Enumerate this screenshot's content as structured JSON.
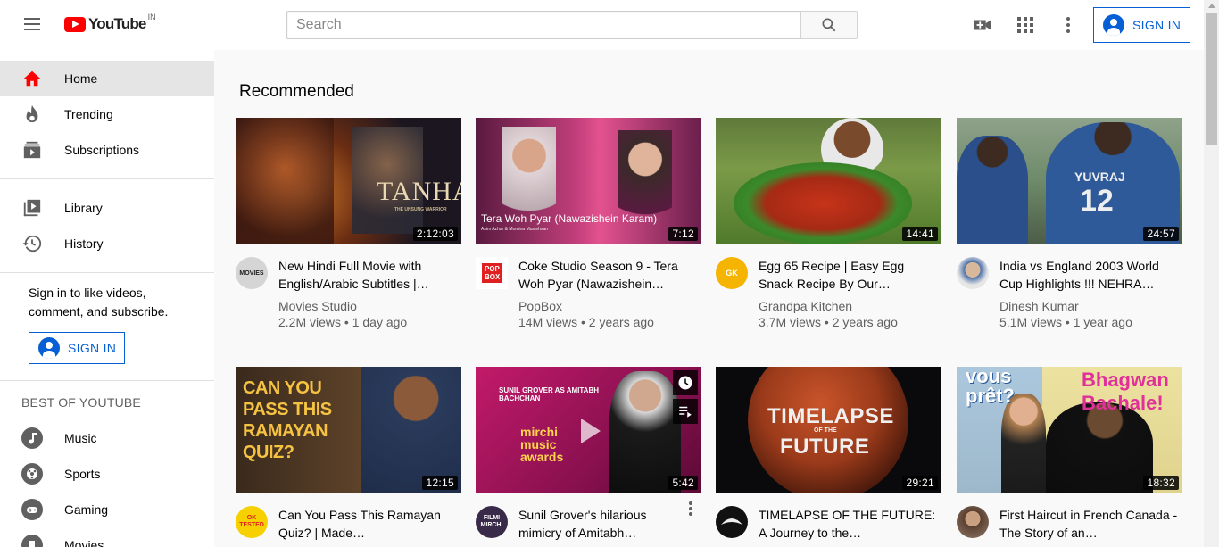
{
  "header": {
    "logo_text": "YouTube",
    "logo_country": "IN",
    "search_placeholder": "Search",
    "signin_label": "SIGN IN"
  },
  "sidebar": {
    "main_items": [
      {
        "label": "Home",
        "icon": "home-icon"
      },
      {
        "label": "Trending",
        "icon": "flame-icon"
      },
      {
        "label": "Subscriptions",
        "icon": "subscriptions-icon"
      }
    ],
    "library_items": [
      {
        "label": "Library",
        "icon": "library-icon"
      },
      {
        "label": "History",
        "icon": "history-icon"
      }
    ],
    "signin_message": "Sign in to like videos, comment, and subscribe.",
    "signin_label": "SIGN IN",
    "best_heading": "BEST OF YOUTUBE",
    "best_items": [
      {
        "label": "Music",
        "icon": "music-icon"
      },
      {
        "label": "Sports",
        "icon": "sports-icon"
      },
      {
        "label": "Gaming",
        "icon": "gaming-icon"
      },
      {
        "label": "Movies",
        "icon": "movies-icon"
      }
    ]
  },
  "main": {
    "section_title": "Recommended",
    "videos": [
      {
        "title": "New Hindi Full Movie with English/Arabic Subtitles |…",
        "channel": "Movies Studio",
        "stats": "2.2M views • 1 day ago",
        "duration": "2:12:03",
        "thumb_text": "TANHAJI",
        "thumb_subtext": "THE UNSUNG WARRIOR",
        "avatar_text": "MOVIES"
      },
      {
        "title": "Coke Studio Season 9 - Tera Woh Pyar (Nawazishein…",
        "channel": "PopBox",
        "stats": "14M views • 2 years ago",
        "duration": "7:12",
        "thumb_text": "Tera Woh Pyar (Nawazishein Karam)",
        "thumb_subtext": "Asim Azhar & Momina Mustehsan",
        "avatar_text": "POP BOX"
      },
      {
        "title": "Egg 65 Recipe | Easy Egg Snack Recipe By Our…",
        "channel": "Grandpa Kitchen",
        "stats": "3.7M views • 2 years ago",
        "duration": "14:41",
        "avatar_text": "GK"
      },
      {
        "title": "India vs England 2003 World Cup Highlights !!! NEHRA…",
        "channel": "Dinesh Kumar",
        "stats": "5.1M views • 1 year ago",
        "duration": "24:57",
        "thumb_text": "YUVRAJ",
        "thumb_subtext": "12"
      },
      {
        "title": "Can You Pass This Ramayan Quiz? | Made…",
        "channel": "",
        "stats": "",
        "duration": "12:15",
        "thumb_text": "CAN YOU PASS THIS RAMAYAN QUIZ?",
        "avatar_text": "OK TESTED"
      },
      {
        "title": "Sunil Grover's hilarious mimicry of Amitabh…",
        "channel": "",
        "stats": "",
        "duration": "5:42",
        "thumb_text": "SUNIL GROVER AS AMITABH BACHCHAN",
        "thumb_subtext": "mirchi music awards",
        "avatar_text": "FILMI MIRCHI"
      },
      {
        "title": "TIMELAPSE OF THE FUTURE: A Journey to the…",
        "channel": "",
        "stats": "",
        "duration": "29:21",
        "thumb_text": "TIMELAPSE",
        "thumb_subtext": "FUTURE",
        "thumb_mid": "OF THE"
      },
      {
        "title": "First Haircut in French Canada - The Story of an…",
        "channel": "",
        "stats": "",
        "duration": "18:32",
        "thumb_text": "vous prêt?",
        "thumb_subtext": "Bhagwan Bachale!"
      }
    ]
  },
  "colors": {
    "brand_red": "#ff0000",
    "link_blue": "#065fd4",
    "text_secondary": "#606060"
  }
}
